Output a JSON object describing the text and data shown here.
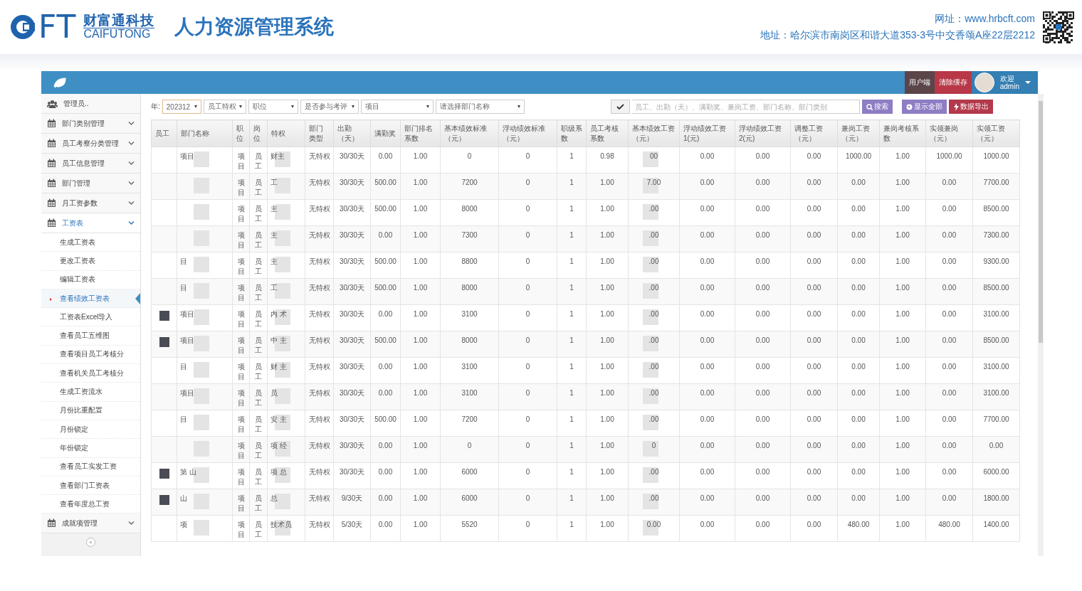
{
  "header": {
    "logo_text": "FT",
    "company_cn": "财富通科技",
    "company_en": "CAIFUTONG",
    "system_title": "人力资源管理系统",
    "website": "网址：www.hrbcft.com",
    "address": "地址：哈尔滨市南岗区和谐大道353-3号中交香颂A座22层2212"
  },
  "topbar": {
    "buttons": [
      {
        "label": "用户端",
        "kind": "client"
      },
      {
        "label": "清除缓存",
        "kind": "cache"
      }
    ],
    "user": {
      "greeting": "欢迎",
      "name": "admin"
    }
  },
  "sidebar": {
    "items": [
      {
        "label": "管理员..",
        "kind": "users",
        "expanded": false
      },
      {
        "label": "部门类别管理",
        "kind": "menu",
        "expanded": false
      },
      {
        "label": "员工考察分类管理",
        "kind": "menu",
        "expanded": false
      },
      {
        "label": "员工信息管理",
        "kind": "menu",
        "expanded": false
      },
      {
        "label": "部门管理",
        "kind": "menu",
        "expanded": false
      },
      {
        "label": "月工资参数",
        "kind": "menu",
        "expanded": false
      },
      {
        "label": "工资表",
        "kind": "menu",
        "expanded": true,
        "children": [
          {
            "label": "生成工资表",
            "selected": false
          },
          {
            "label": "更改工资表",
            "selected": false
          },
          {
            "label": "编辑工资表",
            "selected": false
          },
          {
            "label": "查看绩效工资表",
            "selected": true
          },
          {
            "label": "工资表Excel导入",
            "selected": false
          },
          {
            "label": "查看员工五维图",
            "selected": false
          },
          {
            "label": "查看项目员工考核分",
            "selected": false
          },
          {
            "label": "查看机关员工考核分",
            "selected": false
          },
          {
            "label": "生成工资流水",
            "selected": false
          },
          {
            "label": "月份比重配置",
            "selected": false
          },
          {
            "label": "月份锁定",
            "selected": false
          },
          {
            "label": "年份锁定",
            "selected": false
          },
          {
            "label": "查看员工实发工资",
            "selected": false
          },
          {
            "label": "查看部门工资表",
            "selected": false
          },
          {
            "label": "查看年度总工资",
            "selected": false
          }
        ]
      },
      {
        "label": "成就项管理",
        "kind": "menu",
        "expanded": false
      }
    ],
    "collapse": "«"
  },
  "filters": {
    "year_label": "年:",
    "selects": [
      {
        "text": "202312",
        "focused": true
      },
      {
        "text": "员工特权",
        "focused": false
      },
      {
        "text": "职位",
        "focused": false
      },
      {
        "text": "是否参与考评",
        "focused": false
      },
      {
        "text": "项目",
        "focused": false
      },
      {
        "text": "请选择部门名称",
        "focused": false
      }
    ],
    "search": {
      "placeholder": "员工、出勤（天）、满勤奖、兼岗工资、部门名称、部门类别"
    },
    "buttons": [
      {
        "label": "搜索",
        "kind": "search"
      },
      {
        "label": "显示全部",
        "kind": "show_all"
      },
      {
        "label": "数据导出",
        "kind": "export"
      }
    ]
  },
  "table": {
    "columns": [
      "员工",
      "部门名称",
      "职位",
      "岗位",
      "特权",
      "部门类型",
      "出勤（天）",
      "满勤奖",
      "部门排名系数",
      "基本绩效标准（元）",
      "浮动绩效标准（元）",
      "职级系数",
      "员工考核系数",
      "基本绩效工资（元）",
      "浮动绩效工资1(元)",
      "浮动绩效工资2(元)",
      "调整工资（元）",
      "兼岗工资（元）",
      "兼岗考核系数",
      "实领兼岗（元）",
      "实领工资（元）"
    ],
    "rows": [
      {
        "cells": [
          "",
          "项目",
          "项目",
          "员工",
          "财主",
          "无特权",
          "30/30天",
          "0.00",
          "1.00",
          "0",
          "0",
          "1",
          "0.98",
          "00",
          "0.00",
          "0.00",
          "0.00",
          "1000.00",
          "1.00",
          "1000.00",
          "1000.00"
        ]
      },
      {
        "cells": [
          "",
          "",
          "项目",
          "员工",
          "工",
          "无特权",
          "30/30天",
          "500.00",
          "1.00",
          "7200",
          "0",
          "1",
          "1.00",
          "7.00",
          "0.00",
          "0.00",
          "0.00",
          "0.00",
          "1.00",
          "0.00",
          "7700.00"
        ]
      },
      {
        "cells": [
          "",
          "",
          "项目",
          "员工",
          "主",
          "无特权",
          "30/30天",
          "500.00",
          "1.00",
          "8000",
          "0",
          "1",
          "1.00",
          ".00",
          "0.00",
          "0.00",
          "0.00",
          "0.00",
          "1.00",
          "0.00",
          "8500.00"
        ]
      },
      {
        "cells": [
          "",
          "",
          "项目",
          "员工",
          "主",
          "无特权",
          "30/30天",
          "0.00",
          "1.00",
          "7300",
          "0",
          "1",
          "1.00",
          ".00",
          "0.00",
          "0.00",
          "0.00",
          "0.00",
          "1.00",
          "0.00",
          "7300.00"
        ]
      },
      {
        "cells": [
          "",
          "目",
          "项目",
          "员工",
          "主",
          "无特权",
          "30/30天",
          "500.00",
          "1.00",
          "8800",
          "0",
          "1",
          "1.00",
          ".00",
          "0.00",
          "0.00",
          "0.00",
          "0.00",
          "1.00",
          "0.00",
          "9300.00"
        ]
      },
      {
        "cells": [
          "",
          "目",
          "项目",
          "员工",
          "工",
          "无特权",
          "30/30天",
          "500.00",
          "1.00",
          "8000",
          "0",
          "1",
          "1.00",
          ".00",
          "0.00",
          "0.00",
          "0.00",
          "0.00",
          "1.00",
          "0.00",
          "8500.00"
        ]
      },
      {
        "photo": true,
        "cells": [
          "",
          "项目",
          "项目",
          "员工",
          "内 术",
          "无特权",
          "30/30天",
          "0.00",
          "1.00",
          "3100",
          "0",
          "1",
          "1.00",
          ".00",
          "0.00",
          "0.00",
          "0.00",
          "0.00",
          "1.00",
          "0.00",
          "3100.00"
        ]
      },
      {
        "photo": true,
        "cells": [
          "",
          "项目",
          "项目",
          "员工",
          "中 主",
          "无特权",
          "30/30天",
          "500.00",
          "1.00",
          "8000",
          "0",
          "1",
          "1.00",
          ".00",
          "0.00",
          "0.00",
          "0.00",
          "0.00",
          "1.00",
          "0.00",
          "8500.00"
        ]
      },
      {
        "cells": [
          "",
          "目",
          "项目",
          "员工",
          "财 主",
          "无特权",
          "30/30天",
          "0.00",
          "1.00",
          "3100",
          "0",
          "1",
          "1.00",
          ".00",
          "0.00",
          "0.00",
          "0.00",
          "0.00",
          "1.00",
          "0.00",
          "3100.00"
        ]
      },
      {
        "cells": [
          "",
          "项目",
          "项目",
          "员工",
          "员",
          "无特权",
          "30/30天",
          "0.00",
          "1.00",
          "3100",
          "0",
          "1",
          "1.00",
          ".00",
          "0.00",
          "0.00",
          "0.00",
          "0.00",
          "1.00",
          "0.00",
          "3100.00"
        ]
      },
      {
        "cells": [
          "",
          "目",
          "项目",
          "员工",
          "安 主",
          "无特权",
          "30/30天",
          "500.00",
          "1.00",
          "7200",
          "0",
          "1",
          "1.00",
          ".00",
          "0.00",
          "0.00",
          "0.00",
          "0.00",
          "1.00",
          "0.00",
          "7700.00"
        ]
      },
      {
        "cells": [
          "",
          "",
          "项目",
          "员工",
          "项 经",
          "无特权",
          "30/30天",
          "0.00",
          "1.00",
          "0",
          "0",
          "1",
          "1.00",
          "0",
          "0.00",
          "0.00",
          "0.00",
          "0.00",
          "1.00",
          "0.00",
          "0.00"
        ]
      },
      {
        "photo": true,
        "cells": [
          "",
          "第 山",
          "项目",
          "员工",
          "项 总",
          "无特权",
          "30/30天",
          "0.00",
          "1.00",
          "6000",
          "0",
          "1",
          "1.00",
          ".00",
          "0.00",
          "0.00",
          "0.00",
          "0.00",
          "1.00",
          "0.00",
          "6000.00"
        ]
      },
      {
        "photo": true,
        "cells": [
          "",
          "山",
          "项目",
          "员工",
          "总",
          "无特权",
          "9/30天",
          "0.00",
          "1.00",
          "6000",
          "0",
          "1",
          "1.00",
          ".00",
          "0.00",
          "0.00",
          "0.00",
          "0.00",
          "1.00",
          "0.00",
          "1800.00"
        ]
      },
      {
        "cells": [
          "",
          "项",
          "项目",
          "员工",
          "技术员",
          "无特权",
          "5/30天",
          "0.00",
          "1.00",
          "5520",
          "0",
          "1",
          "1.00",
          "0.00",
          "0.00",
          "0.00",
          "0.00",
          "480.00",
          "1.00",
          "480.00",
          "1400.00"
        ]
      }
    ]
  }
}
